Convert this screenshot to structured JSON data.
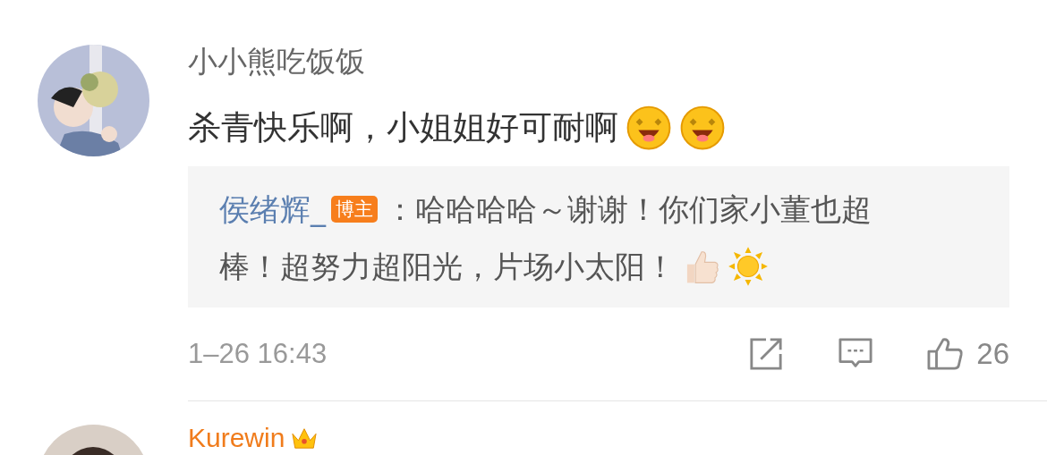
{
  "comments": [
    {
      "author": "小小熊吃饭饭",
      "vip": false,
      "avatar": {
        "kind": "picture"
      },
      "text": "杀青快乐啊，小姐姐好可耐啊",
      "emojis": [
        {
          "kind": "grin"
        },
        {
          "kind": "grin"
        }
      ],
      "reply": {
        "author": "侯绪辉_",
        "badge": "博主",
        "lines": [
          "：哈哈哈哈～谢谢！你们家小董也超",
          "棒！超努力超阳光，片场小太阳！"
        ],
        "emojis": [
          {
            "kind": "thumbs-up"
          },
          {
            "kind": "sun"
          }
        ]
      },
      "time": "1–26 16:43",
      "likes": "26"
    },
    {
      "author": "Kurewin",
      "vip": true,
      "avatar": {
        "kind": "picture"
      },
      "badges": [
        {
          "kind": "crown"
        }
      ]
    }
  ]
}
